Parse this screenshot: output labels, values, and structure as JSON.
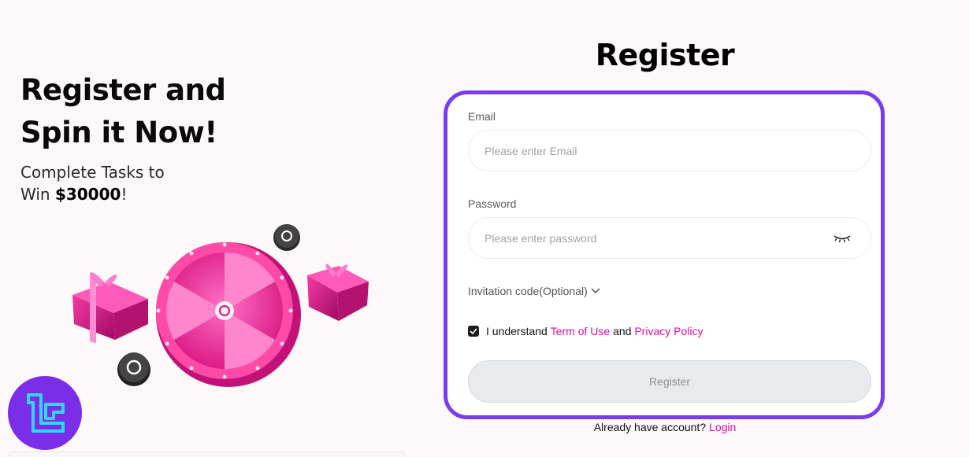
{
  "promo": {
    "title_line1": "Register and",
    "title_line2": "Spin it Now!",
    "subtitle_line1": "Complete Tasks to",
    "subtitle_win": "Win ",
    "subtitle_amount": "$30000",
    "subtitle_end": "!"
  },
  "form": {
    "title": "Register",
    "email_label": "Email",
    "email_placeholder": "Please enter Email",
    "email_value": "",
    "password_label": "Password",
    "password_placeholder": "Please enter password",
    "password_value": "",
    "invitation_label": "Invitation code(Optional)",
    "agree_text": "I understand ",
    "terms_link": "Term of Use",
    "and_text": " and ",
    "privacy_link": "Privacy Policy",
    "register_button": "Register",
    "have_account": "Already have account? ",
    "login_link": "Login"
  },
  "colors": {
    "accent_border": "#7a3cf0",
    "link": "#d512a0",
    "wheel": "#f0399f"
  },
  "icons": [
    "eye-closed-icon",
    "chevron-down-icon",
    "check-icon",
    "gift-icon",
    "spin-wheel-icon",
    "timer-icon",
    "brand-logo"
  ]
}
